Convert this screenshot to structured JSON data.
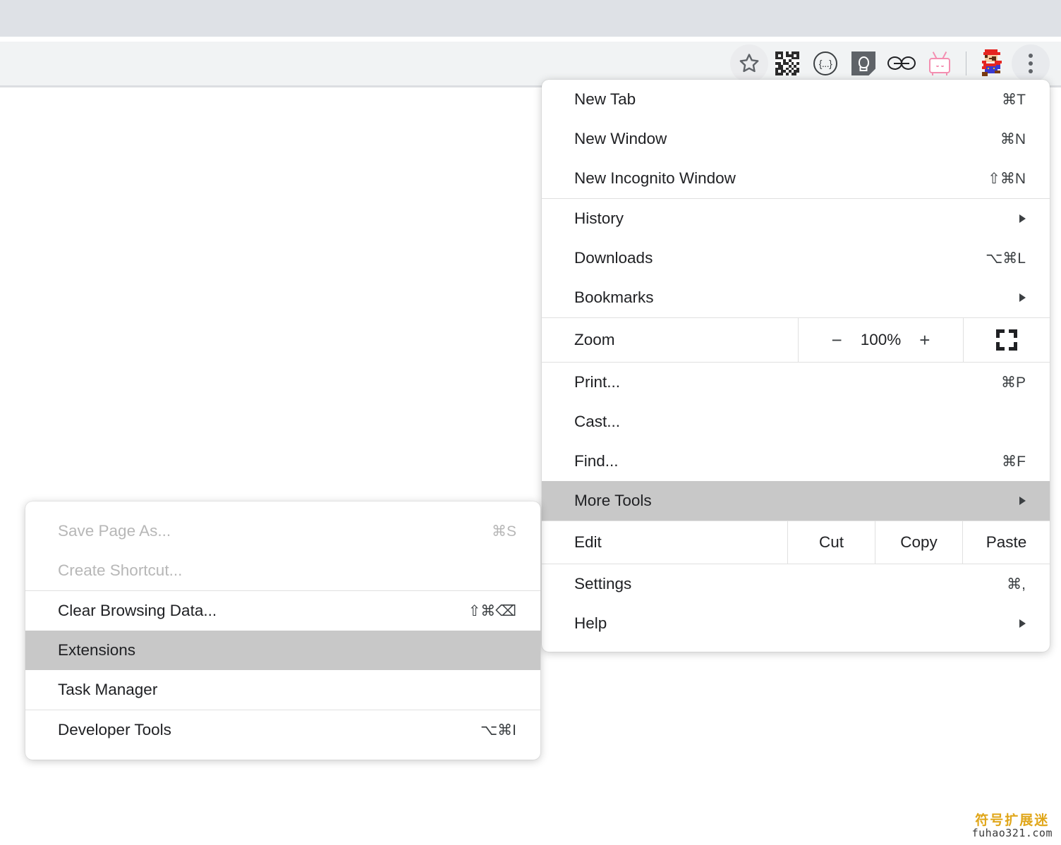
{
  "toolbar": {
    "icons": [
      {
        "name": "bookmark-star-icon",
        "label": "Bookmark this tab"
      },
      {
        "name": "qr-code-icon",
        "label": "Create QR code"
      },
      {
        "name": "braces-icon",
        "label": "{...}"
      },
      {
        "name": "lightbulb-note-icon",
        "label": "Notes"
      },
      {
        "name": "glasses-icon",
        "label": "Reader"
      },
      {
        "name": "tv-icon",
        "label": "TV"
      },
      {
        "name": "profile-avatar",
        "label": "Mario"
      },
      {
        "name": "chrome-menu-button",
        "label": "Customize and control Google Chrome"
      }
    ],
    "braces_text": "{...}"
  },
  "main_menu": {
    "items": [
      {
        "label": "New Tab",
        "accel": "⌘T",
        "type": "item"
      },
      {
        "label": "New Window",
        "accel": "⌘N",
        "type": "item"
      },
      {
        "label": "New Incognito Window",
        "accel": "⇧⌘N",
        "type": "item"
      },
      {
        "type": "separator"
      },
      {
        "label": "History",
        "accel": "",
        "type": "submenu"
      },
      {
        "label": "Downloads",
        "accel": "⌥⌘L",
        "type": "item"
      },
      {
        "label": "Bookmarks",
        "accel": "",
        "type": "submenu"
      },
      {
        "type": "separator"
      },
      {
        "label": "Zoom",
        "type": "zoom"
      },
      {
        "type": "separator"
      },
      {
        "label": "Print...",
        "accel": "⌘P",
        "type": "item"
      },
      {
        "label": "Cast...",
        "accel": "",
        "type": "item"
      },
      {
        "label": "Find...",
        "accel": "⌘F",
        "type": "item"
      },
      {
        "label": "More Tools",
        "accel": "",
        "type": "submenu",
        "highlighted": true
      },
      {
        "type": "separator"
      },
      {
        "label": "Edit",
        "type": "edit"
      },
      {
        "type": "separator"
      },
      {
        "label": "Settings",
        "accel": "⌘,",
        "type": "item"
      },
      {
        "label": "Help",
        "accel": "",
        "type": "submenu"
      }
    ],
    "zoom": {
      "label": "Zoom",
      "minus": "−",
      "level": "100%",
      "plus": "+",
      "fullscreen_icon": "fullscreen-icon"
    },
    "edit": {
      "label": "Edit",
      "actions": [
        "Cut",
        "Copy",
        "Paste"
      ]
    }
  },
  "more_tools_submenu": {
    "items": [
      {
        "label": "Save Page As...",
        "accel": "⌘S",
        "disabled": true
      },
      {
        "label": "Create Shortcut...",
        "accel": "",
        "disabled": true
      },
      {
        "type": "separator"
      },
      {
        "label": "Clear Browsing Data...",
        "accel": "⇧⌘⌫",
        "disabled": false
      },
      {
        "label": "Extensions",
        "accel": "",
        "disabled": false,
        "highlighted": true
      },
      {
        "label": "Task Manager",
        "accel": "",
        "disabled": false
      },
      {
        "type": "separator"
      },
      {
        "label": "Developer Tools",
        "accel": "⌥⌘I",
        "disabled": false
      }
    ]
  },
  "watermark": {
    "cn": "符号扩展迷",
    "en": "fuhao321.com"
  },
  "colors": {
    "tabstrip": "#dee1e6",
    "toolbar": "#f1f3f4",
    "menu_bg": "#ffffff",
    "highlight": "#c8c8c8",
    "text": "#202124",
    "disabled_text": "#b7b7b7",
    "separator": "#e0e0e0",
    "watermark_gold": "#e0a619"
  }
}
